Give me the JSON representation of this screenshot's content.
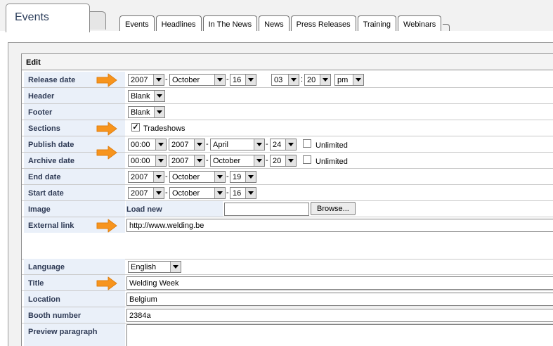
{
  "window": {
    "main_tab": "Events",
    "tabs": [
      "Events",
      "Headlines",
      "In The News",
      "News",
      "Press Releases",
      "Training",
      "Webinars"
    ]
  },
  "panel": {
    "title": "Edit"
  },
  "colors": {
    "label_bg": "#eaf0f9",
    "label_text": "#2e3a55",
    "arrow": "#f7941d"
  },
  "form": {
    "release_date": {
      "label": "Release date",
      "year": "2007",
      "month": "October",
      "day": "16",
      "hour": "03",
      "minute": "20",
      "ampm": "pm"
    },
    "header": {
      "label": "Header",
      "value": "Blank"
    },
    "footer": {
      "label": "Footer",
      "value": "Blank"
    },
    "sections": {
      "label": "Sections",
      "option": "Tradeshows",
      "checked": true
    },
    "publish_date": {
      "label": "Publish date",
      "time": "00:00",
      "year": "2007",
      "month": "April",
      "day": "24",
      "unlimited": "Unlimited"
    },
    "archive_date": {
      "label": "Archive date",
      "time": "00:00",
      "year": "2007",
      "month": "October",
      "day": "20",
      "unlimited": "Unlimited"
    },
    "end_date": {
      "label": "End date",
      "year": "2007",
      "month": "October",
      "day": "19"
    },
    "start_date": {
      "label": "Start date",
      "year": "2007",
      "month": "October",
      "day": "16"
    },
    "image": {
      "label": "Image",
      "load_new": "Load new",
      "file_value": "",
      "browse": "Browse..."
    },
    "external_link": {
      "label": "External link",
      "value": "http://www.welding.be"
    },
    "language": {
      "label": "Language",
      "value": "English"
    },
    "title": {
      "label": "Title",
      "value": "Welding Week"
    },
    "location": {
      "label": "Location",
      "value": "Belgium"
    },
    "booth_number": {
      "label": "Booth number",
      "value": "2384a"
    },
    "preview_paragraph": {
      "label": "Preview paragraph",
      "value": ""
    }
  },
  "arrows": [
    {
      "icon": "orange-arrow-icon",
      "points_to": "Release date"
    },
    {
      "icon": "orange-arrow-icon",
      "points_to": "Sections"
    },
    {
      "icon": "orange-arrow-icon",
      "points_to": "Publish date"
    },
    {
      "icon": "orange-arrow-icon",
      "points_to": "External link"
    },
    {
      "icon": "orange-arrow-icon",
      "points_to": "Title"
    }
  ]
}
